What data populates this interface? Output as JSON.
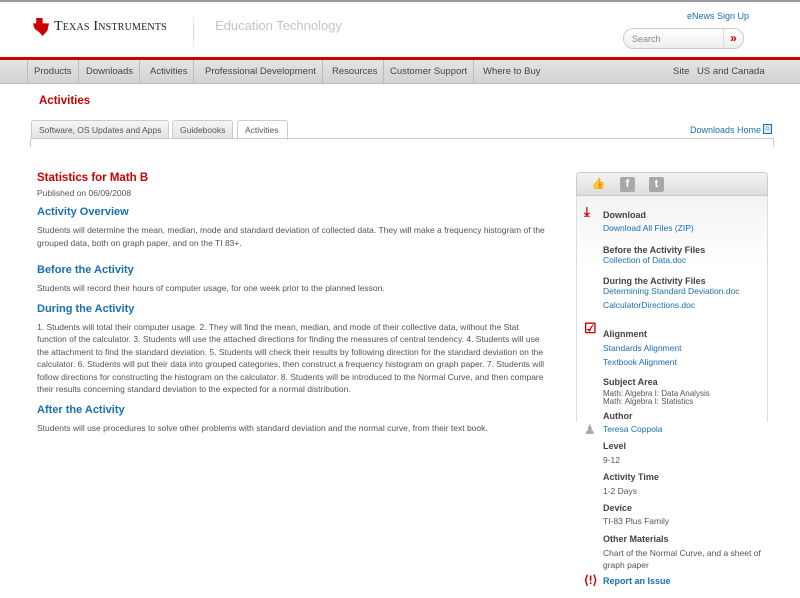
{
  "header": {
    "brand": "Texas Instruments",
    "section": "Education Technology",
    "enews": "eNews Sign Up",
    "search_placeholder": "Search",
    "search_go": "»"
  },
  "nav": {
    "items": [
      "Products",
      "Downloads",
      "Activities",
      "Professional Development",
      "Resources",
      "Customer Support",
      "Where to Buy"
    ],
    "site_label": "Site",
    "site_value": "US and Canada"
  },
  "page_heading": "Activities",
  "tabs": [
    "Software, OS Updates and Apps",
    "Guidebooks",
    "Activities"
  ],
  "active_tab": "Activities",
  "downloads_home": "Downloads Home",
  "main": {
    "title": "Statistics for Math B",
    "published": "Published on 06/09/2008",
    "sections": [
      {
        "heading": "Activity Overview",
        "text": "Students will determine the mean, median, mode and standard deviation of collected data. They will make a frequency histogram of the grouped data, both on graph paper, and on the TI 83+."
      },
      {
        "heading": "Before the Activity",
        "text": "Students will record their hours of computer usage, for one week prior to the planned lesson."
      },
      {
        "heading": "During the Activity",
        "text": "1. Students will total their computer usage. 2. They will find the mean, median, and mode of their collective data, without the Stat function of the calculator. 3. Students will use the attached directions for finding the measures of central tendency. 4. Students will use the attachment to find the standard deviation. 5. Students will check their results by following direction for the standard deviation on the calculator. 6. Students will put their data into grouped categories, then construct a frequency histogram on graph paper. 7. Students will follow directions for constructing the histogram on the calculator. 8. Students will be introduced to the Normal Curve, and then compare their results concerning standard deviation to the expected for a normal distribution."
      },
      {
        "heading": "After the Activity",
        "text": "Students will use procedures to solve other problems with standard deviation and the normal curve, from their text book."
      }
    ]
  },
  "sidebar": {
    "social": [
      "like-icon",
      "facebook-icon",
      "twitter-icon"
    ],
    "download": "Download",
    "download_all": "Download All Files (ZIP)",
    "before_files": "Before the Activity Files",
    "before_file1": "Collection of Data.doc",
    "during_files": "During the Activity Files",
    "during_file1": "Determining Standard Deviation.doc",
    "during_file2": "CalculatorDirections.doc",
    "alignment": "Alignment",
    "standards": "Standards Alignment",
    "textbook": "Textbook Alignment",
    "subject_area": "Subject Area",
    "subject1": "Math: Algebra I: Data Analysis",
    "subject2": "Math: Algebra I: Statistics",
    "author_label": "Author",
    "author": "Teresa Coppola",
    "level_label": "Level",
    "level": "9-12",
    "time_label": "Activity Time",
    "time": "1-2 Days",
    "device_label": "Device",
    "device": "TI-83 Plus Family",
    "materials_label": "Other Materials",
    "materials": "Chart of the Normal Curve, and a sheet of graph paper",
    "report": "Report an Issue"
  },
  "colors": {
    "brand_red": "#cc0000",
    "link_blue": "#1a6fb0"
  }
}
